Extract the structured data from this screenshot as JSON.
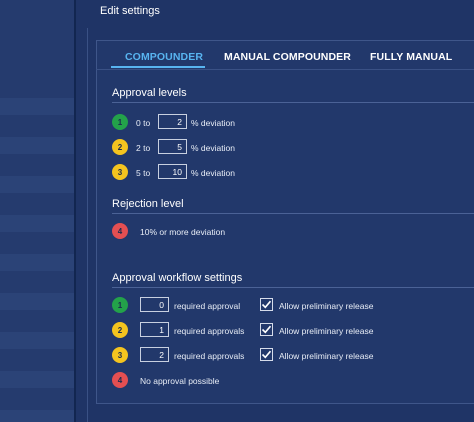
{
  "panel": {
    "title": "Edit settings"
  },
  "tabs": [
    {
      "label": "COMPOUNDER",
      "active": true
    },
    {
      "label": "MANUAL COMPOUNDER",
      "active": false
    },
    {
      "label": "FULLY MANUAL",
      "active": false
    }
  ],
  "approval_levels": {
    "title": "Approval levels",
    "rows": [
      {
        "badge": "1",
        "color": "#23a24a",
        "from": "0 to",
        "value": "2",
        "unit": "% deviation"
      },
      {
        "badge": "2",
        "color": "#f4c41f",
        "from": "2 to",
        "value": "5",
        "unit": "% deviation"
      },
      {
        "badge": "3",
        "color": "#f4c41f",
        "from": "5 to",
        "value": "10",
        "unit": "% deviation"
      }
    ]
  },
  "rejection_level": {
    "title": "Rejection level",
    "badge": "4",
    "color": "#e44f52",
    "text": "10% or more deviation"
  },
  "workflow": {
    "title": "Approval workflow settings",
    "rows": [
      {
        "badge": "1",
        "color": "#23a24a",
        "value": "0",
        "label": "required approval",
        "checkbox_label": "Allow preliminary release",
        "checked": true
      },
      {
        "badge": "2",
        "color": "#f4c41f",
        "value": "1",
        "label": "required approvals",
        "checkbox_label": "Allow preliminary release",
        "checked": true
      },
      {
        "badge": "3",
        "color": "#f4c41f",
        "value": "2",
        "label": "required approvals",
        "checkbox_label": "Allow preliminary release",
        "checked": true
      }
    ],
    "no_approval": {
      "badge": "4",
      "color": "#e44f52",
      "text": "No approval possible"
    }
  },
  "icons": {
    "check": "check-icon"
  }
}
